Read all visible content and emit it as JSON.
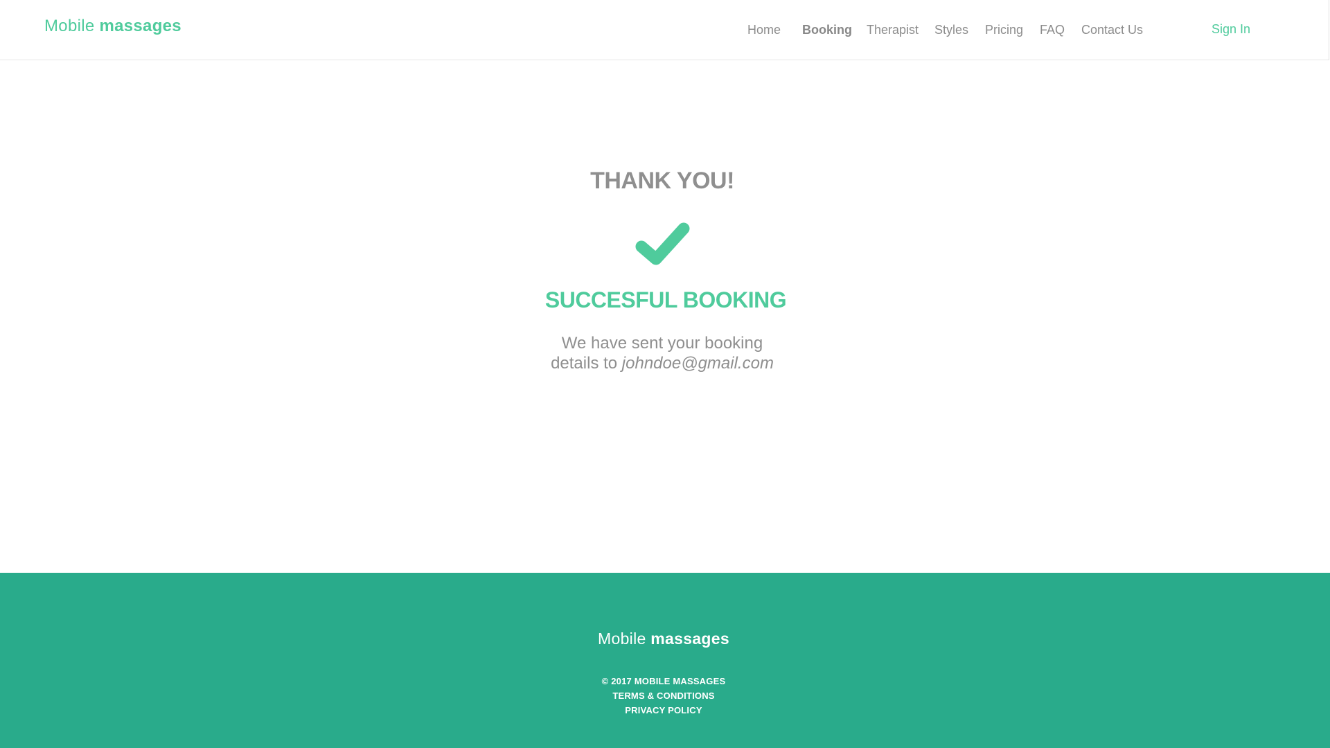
{
  "header": {
    "logo": {
      "light": "Mobile",
      "bold": "massages"
    },
    "nav": [
      {
        "label": "Home"
      },
      {
        "label": "Booking",
        "active": true
      },
      {
        "label": "Therapist"
      },
      {
        "label": "Styles"
      },
      {
        "label": "Pricing"
      },
      {
        "label": "FAQ"
      },
      {
        "label": "Contact Us"
      }
    ],
    "signin": "Sign In"
  },
  "main": {
    "title": "THANK YOU!",
    "icon": "checkmark-icon",
    "status": "SUCCESFUL BOOKING",
    "message_line1": "We have sent your booking",
    "message_line2_prefix": "details to ",
    "email": "johndoe@gmail.com"
  },
  "footer": {
    "logo": {
      "light": "Mobile",
      "bold": "massages"
    },
    "copyright": "© 2017 MOBILE MASSAGES",
    "terms": "TERMS & CONDITIONS",
    "privacy": "PRIVACY POLICY"
  },
  "colors": {
    "accent": "#4fcb9c",
    "footer_bg": "#29ab8b",
    "text_gray": "#8f8f8f",
    "background": "#ffffff"
  }
}
